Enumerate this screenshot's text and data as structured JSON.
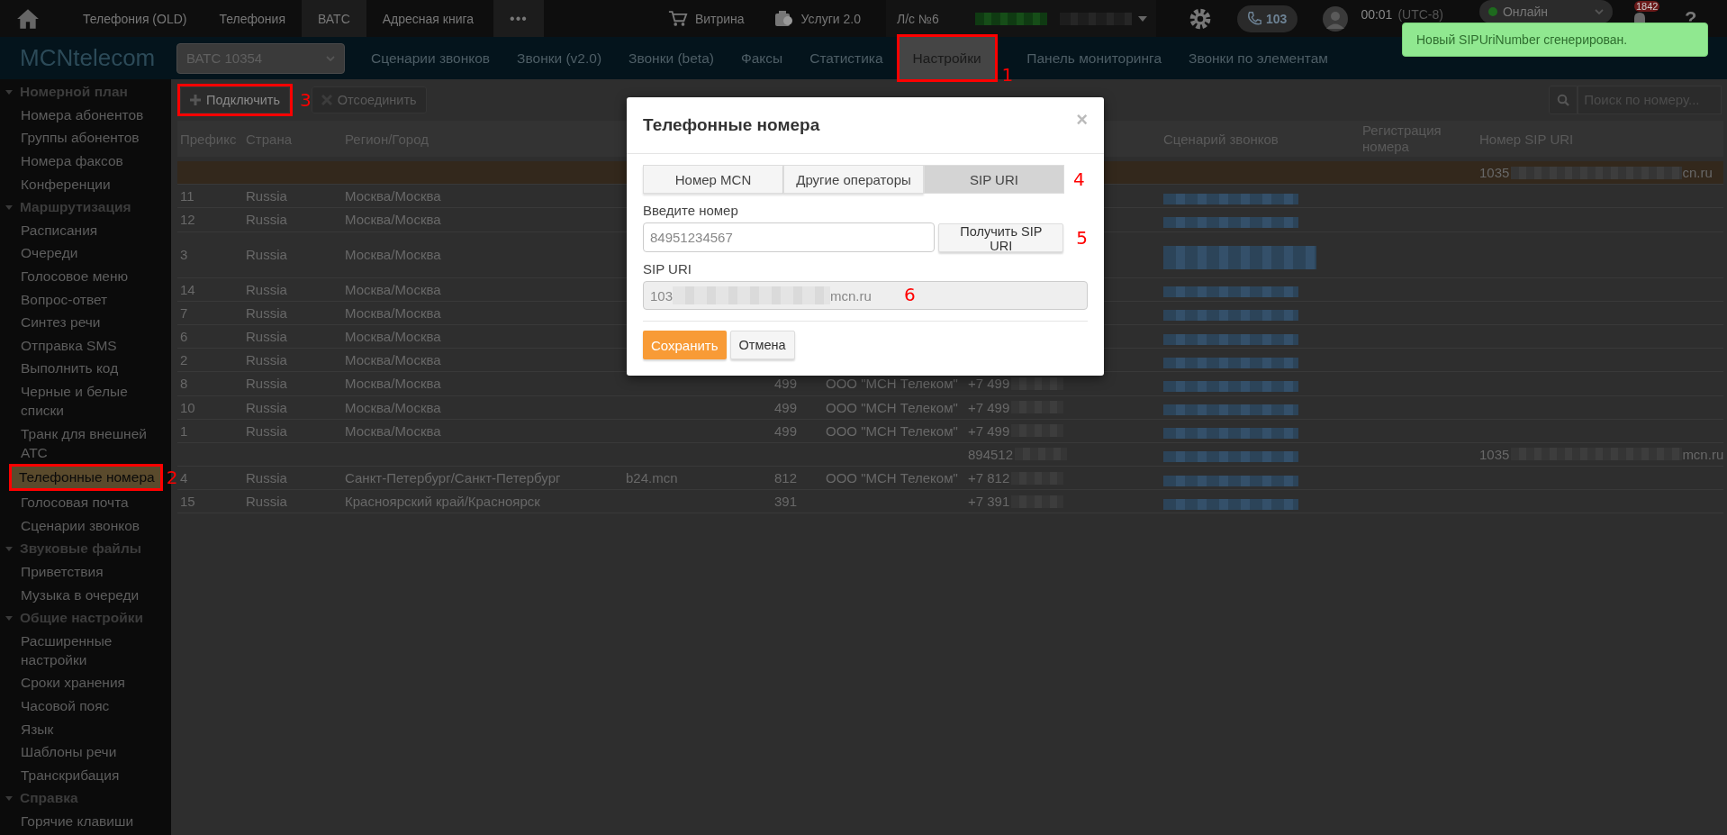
{
  "top_bar": {
    "items": [
      {
        "label": "Телефония (OLD)",
        "selected": false
      },
      {
        "label": "Телефония",
        "selected": false
      },
      {
        "label": "ВАТС",
        "selected": true
      },
      {
        "label": "Адресная книга",
        "selected": false
      }
    ],
    "more": "•••",
    "shop": "Витрина",
    "services": "Услуги 2.0",
    "account": "Л/с №6",
    "calls_badge": "103",
    "timer": "00:01",
    "timezone": "(UTC-8)",
    "status": "Онлайн",
    "notifications": "1842",
    "help": "?"
  },
  "nav_bar": {
    "logo": "MCNtelecom",
    "pbx_select": "ВАТС 10354",
    "items": [
      {
        "label": "Сценарии звонков",
        "selected": false
      },
      {
        "label": "Звонки (v2.0)",
        "selected": false
      },
      {
        "label": "Звонки (beta)",
        "selected": false
      },
      {
        "label": "Факсы",
        "selected": false
      },
      {
        "label": "Статистика",
        "selected": false
      },
      {
        "label": "Настройки",
        "selected": true,
        "callout": {
          "number": "1",
          "framed": true
        }
      },
      {
        "label": "Панель мониторинга",
        "selected": false
      },
      {
        "label": "Звонки по элементам",
        "selected": false
      }
    ]
  },
  "sidebar": {
    "groups": [
      {
        "title": "Номерной план",
        "expanded": true,
        "items": [
          {
            "label": "Номера абонентов",
            "selected": false
          },
          {
            "label": "Группы абонентов",
            "selected": false
          },
          {
            "label": "Номера факсов",
            "selected": false
          },
          {
            "label": "Конференции",
            "selected": false
          }
        ]
      },
      {
        "title": "Маршрутизация",
        "expanded": true,
        "items": [
          {
            "label": "Расписания",
            "selected": false
          },
          {
            "label": "Очереди",
            "selected": false
          },
          {
            "label": "Голосовое меню",
            "selected": false
          },
          {
            "label": "Вопрос-ответ",
            "selected": false
          },
          {
            "label": "Синтез речи",
            "selected": false
          },
          {
            "label": "Отправка SMS",
            "selected": false
          },
          {
            "label": "Выполнить код",
            "selected": false
          },
          {
            "label": "Черные и белые списки",
            "selected": false
          },
          {
            "label": "Транк для внешней АТС",
            "selected": false
          },
          {
            "label": "Телефонные номера",
            "selected": true,
            "callout": {
              "number": "2",
              "framed": true
            }
          },
          {
            "label": "Голосовая почта",
            "selected": false
          },
          {
            "label": "Сценарии звонков",
            "selected": false
          }
        ]
      },
      {
        "title": "Звуковые файлы",
        "expanded": true,
        "items": [
          {
            "label": "Приветствия",
            "selected": false
          },
          {
            "label": "Музыка в очереди",
            "selected": false
          }
        ]
      },
      {
        "title": "Общие настройки",
        "expanded": true,
        "items": [
          {
            "label": "Расширенные настройки",
            "selected": false
          },
          {
            "label": "Сроки хранения",
            "selected": false
          },
          {
            "label": "Часовой пояс",
            "selected": false
          },
          {
            "label": "Язык",
            "selected": false
          },
          {
            "label": "Шаблоны речи",
            "selected": false
          },
          {
            "label": "Транскрибация",
            "selected": false
          }
        ]
      },
      {
        "title": "Справка",
        "expanded": true,
        "items": [
          {
            "label": "Горячие клавиши",
            "selected": false
          }
        ]
      }
    ]
  },
  "toolbar": {
    "connect": {
      "label": "Подключить",
      "disabled": false,
      "callout": {
        "number": "3",
        "framed": true
      }
    },
    "disconnect": {
      "label": "Отсоединить",
      "disabled": true
    },
    "search": {
      "placeholder": "Поиск по номеру..."
    }
  },
  "table": {
    "columns": {
      "prefix": "Префикс",
      "country": "Страна",
      "region": "Регион/Город",
      "scenario": "Сценарий звонков",
      "registration": "Регистрация номера",
      "sip_uri": "Номер SIP URI"
    },
    "rows": [
      {
        "selected": true,
        "sip_uri": {
          "prefix": "1035",
          "suffix": "cn.ru"
        }
      },
      {
        "selected": false,
        "prefix": "11",
        "country": "Russia",
        "region": "Москва/Москва",
        "scenario_redacted": true
      },
      {
        "selected": false,
        "prefix": "12",
        "country": "Russia",
        "region": "Москва/Москва",
        "scenario_redacted": true
      },
      {
        "selected": false,
        "prefix": "3",
        "country": "Russia",
        "region": "Москва/Москва",
        "scenario_redacted": true,
        "scenario_wrapped": true
      },
      {
        "selected": false,
        "prefix": "14",
        "country": "Russia",
        "region": "Москва/Москва",
        "scenario_redacted": true
      },
      {
        "selected": false,
        "prefix": "7",
        "country": "Russia",
        "region": "Москва/Москва",
        "scenario_redacted": true
      },
      {
        "selected": false,
        "prefix": "6",
        "country": "Russia",
        "region": "Москва/Москва",
        "scenario_redacted": true
      },
      {
        "selected": false,
        "prefix": "2",
        "country": "Russia",
        "region": "Москва/Москва",
        "scenario_redacted": true
      },
      {
        "selected": false,
        "prefix": "8",
        "country": "Russia",
        "region": "Москва/Москва",
        "code": "499",
        "operator": "ООО \"МСН Телеком\"",
        "number": "+7 499",
        "number_redacted": true,
        "scenario_redacted": true
      },
      {
        "selected": false,
        "prefix": "10",
        "country": "Russia",
        "region": "Москва/Москва",
        "code": "499",
        "operator": "ООО \"МСН Телеком\"",
        "number": "+7 499",
        "number_redacted": true,
        "scenario_redacted": true
      },
      {
        "selected": false,
        "prefix": "1",
        "country": "Russia",
        "region": "Москва/Москва",
        "code": "499",
        "operator": "ООО \"МСН Телеком\"",
        "number": "+7 499",
        "number_redacted": true,
        "scenario_redacted": true
      },
      {
        "selected": false,
        "number": "894512",
        "number_redacted": true,
        "scenario_redacted": true,
        "sip_uri": {
          "prefix": "1035",
          "suffix": "mcn.ru"
        }
      },
      {
        "selected": false,
        "prefix": "4",
        "country": "Russia",
        "region": "Санкт-Петербург/Санкт-Петербург",
        "host": "b24.mcn",
        "code": "812",
        "operator": "ООО \"МСН Телеком\"",
        "number": "+7 812",
        "number_redacted": true,
        "scenario_redacted": true
      },
      {
        "selected": false,
        "prefix": "15",
        "country": "Russia",
        "region": "Красноярский край/Красноярск",
        "code": "391",
        "number": "+7 391",
        "number_redacted": true,
        "scenario_redacted": true
      }
    ]
  },
  "dialog": {
    "title": "Телефонные номера",
    "close": "×",
    "tabs": [
      {
        "label": "Номер MCN",
        "selected": false
      },
      {
        "label": "Другие операторы",
        "selected": false
      },
      {
        "label": "SIP URI",
        "selected": true,
        "callout": {
          "number": "4",
          "framed": false
        }
      }
    ],
    "number_label": "Введите номер",
    "number_input": {
      "placeholder": "84951234567"
    },
    "get_button": {
      "label": "Получить SIP URI",
      "callout": {
        "number": "5",
        "framed": false
      }
    },
    "sip_label": "SIP URI",
    "sip_field": {
      "prefix": "103",
      "suffix": "mcn.ru",
      "callout": {
        "number": "6",
        "framed": false
      }
    },
    "save": "Сохранить",
    "cancel": "Отмена"
  },
  "toast": {
    "message": "Новый SIPUriNumber сгенерирован."
  }
}
